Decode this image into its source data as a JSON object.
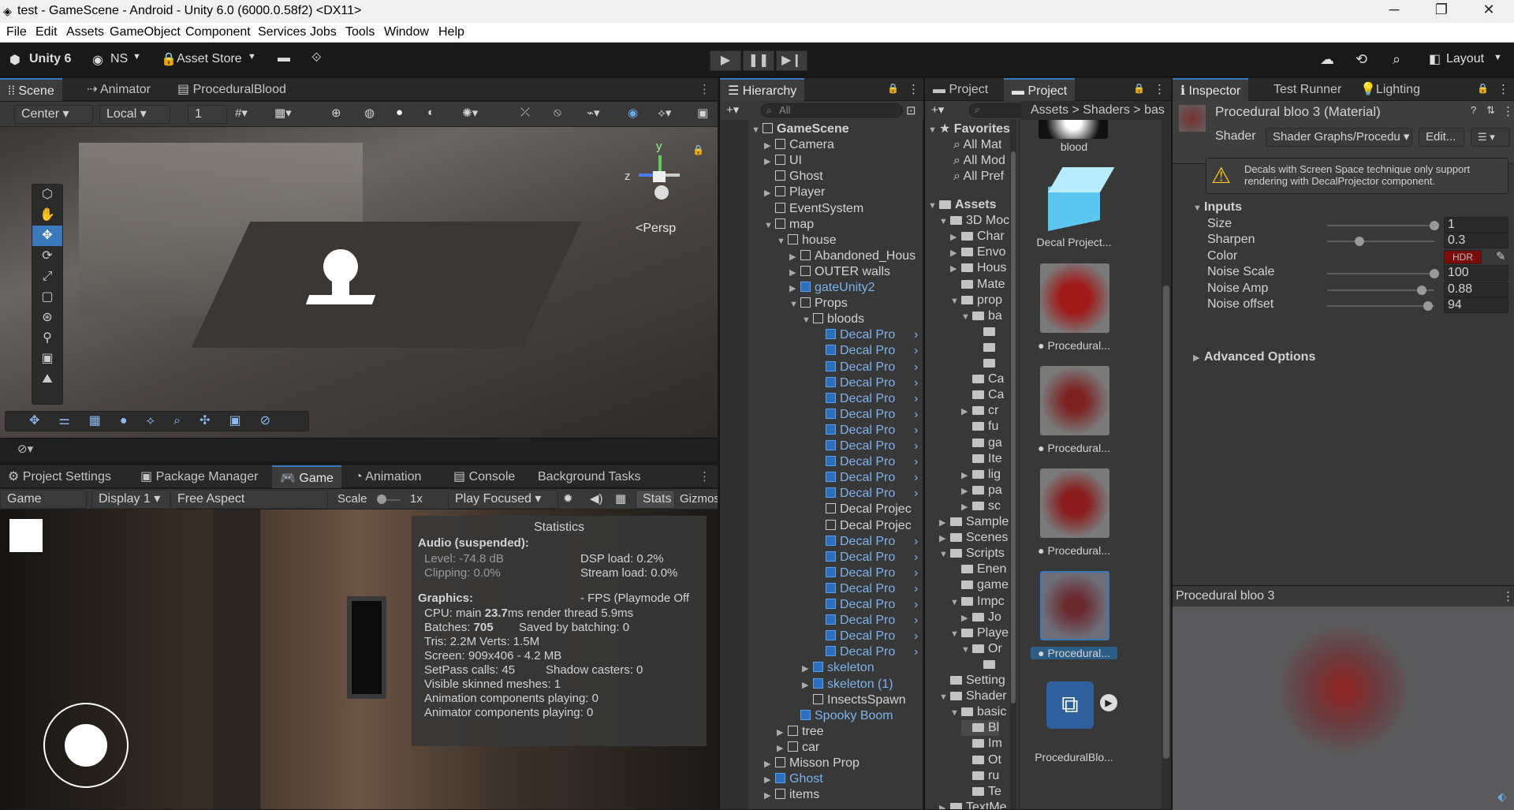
{
  "window": {
    "title": "test - GameScene - Android - Unity 6.0 (6000.0.58f2) <DX11>"
  },
  "menu": [
    "File",
    "Edit",
    "Assets",
    "GameObject",
    "Component",
    "Services",
    "Jobs",
    "Tools",
    "Window",
    "Help"
  ],
  "toolbar": {
    "account": "Unity 6",
    "user": "NS",
    "asset_store": "Asset Store",
    "layout": "Layout"
  },
  "scene_tabs": [
    "Scene",
    "Animator",
    "ProceduralBlood"
  ],
  "scene_toolbar": {
    "pivot": "Center",
    "space": "Local",
    "snap": "1",
    "persp": "<Persp"
  },
  "gizmo_axes": {
    "y": "y",
    "z": "z"
  },
  "game_tabs": [
    "Project Settings",
    "Package Manager",
    "Game",
    "Animation",
    "Console",
    "Background Tasks"
  ],
  "game_toolbar": {
    "mode": "Game",
    "display": "Display 1",
    "aspect": "Free Aspect",
    "scale_label": "Scale",
    "scale_value": "1x",
    "play_mode": "Play Focused",
    "stats": "Stats",
    "gizmos": "Gizmos"
  },
  "stats": {
    "title": "Statistics",
    "audio_header": "Audio (suspended):",
    "level": "Level: -74.8 dB",
    "clipping": "Clipping: 0.0%",
    "dsp": "DSP load: 0.2%",
    "stream": "Stream load: 0.0%",
    "graphics_header": "Graphics:",
    "fps": "- FPS (Playmode Off",
    "cpu_label": "CPU: main ",
    "cpu_main": "23.7",
    "cpu_rest": "ms  render thread 5.9ms",
    "batches_label": "Batches: ",
    "batches": "705",
    "saved": "Saved by batching: 0",
    "tris": "Tris: 2.2M  Verts: 1.5M",
    "screen": "Screen: 909x406 - 4.2 MB",
    "setpass": "SetPass calls: 45",
    "shadow": "Shadow casters: 0",
    "skinned": "Visible skinned meshes: 1",
    "anim": "Animation components playing: 0",
    "animator": "Animator components playing: 0"
  },
  "hierarchy": {
    "tab": "Hierarchy",
    "search_placeholder": "All",
    "items": [
      {
        "label": "GameScene",
        "indent": 0,
        "arrow": "▼",
        "blue": false,
        "bold": true
      },
      {
        "label": "Camera",
        "indent": 1,
        "arrow": "▶",
        "blue": false
      },
      {
        "label": "UI",
        "indent": 1,
        "arrow": "▶",
        "blue": false
      },
      {
        "label": "Ghost",
        "indent": 1,
        "arrow": "",
        "blue": false
      },
      {
        "label": "Player",
        "indent": 1,
        "arrow": "▶",
        "blue": false
      },
      {
        "label": "EventSystem",
        "indent": 1,
        "arrow": "",
        "blue": false
      },
      {
        "label": "map",
        "indent": 1,
        "arrow": "▼",
        "blue": false
      },
      {
        "label": "house",
        "indent": 2,
        "arrow": "▼",
        "blue": false
      },
      {
        "label": "Abandoned_Hous",
        "indent": 3,
        "arrow": "▶",
        "blue": false
      },
      {
        "label": "OUTER walls",
        "indent": 3,
        "arrow": "▶",
        "blue": false
      },
      {
        "label": "gateUnity2",
        "indent": 3,
        "arrow": "▶",
        "blue": true
      },
      {
        "label": "Props",
        "indent": 3,
        "arrow": "▼",
        "blue": false
      },
      {
        "label": "bloods",
        "indent": 4,
        "arrow": "▼",
        "blue": false
      },
      {
        "label": "Decal Pro",
        "indent": 5,
        "arrow": "",
        "blue": true
      },
      {
        "label": "Decal Pro",
        "indent": 5,
        "arrow": "",
        "blue": true
      },
      {
        "label": "Decal Pro",
        "indent": 5,
        "arrow": "",
        "blue": true
      },
      {
        "label": "Decal Pro",
        "indent": 5,
        "arrow": "",
        "blue": true
      },
      {
        "label": "Decal Pro",
        "indent": 5,
        "arrow": "",
        "blue": true
      },
      {
        "label": "Decal Pro",
        "indent": 5,
        "arrow": "",
        "blue": true
      },
      {
        "label": "Decal Pro",
        "indent": 5,
        "arrow": "",
        "blue": true
      },
      {
        "label": "Decal Pro",
        "indent": 5,
        "arrow": "",
        "blue": true
      },
      {
        "label": "Decal Pro",
        "indent": 5,
        "arrow": "",
        "blue": true
      },
      {
        "label": "Decal Pro",
        "indent": 5,
        "arrow": "",
        "blue": true
      },
      {
        "label": "Decal Pro",
        "indent": 5,
        "arrow": "",
        "blue": true
      },
      {
        "label": "Decal Projec",
        "indent": 5,
        "arrow": "",
        "blue": false
      },
      {
        "label": "Decal Projec",
        "indent": 5,
        "arrow": "",
        "blue": false
      },
      {
        "label": "Decal Pro",
        "indent": 5,
        "arrow": "",
        "blue": true
      },
      {
        "label": "Decal Pro",
        "indent": 5,
        "arrow": "",
        "blue": true
      },
      {
        "label": "Decal Pro",
        "indent": 5,
        "arrow": "",
        "blue": true
      },
      {
        "label": "Decal Pro",
        "indent": 5,
        "arrow": "",
        "blue": true
      },
      {
        "label": "Decal Pro",
        "indent": 5,
        "arrow": "",
        "blue": true
      },
      {
        "label": "Decal Pro",
        "indent": 5,
        "arrow": "",
        "blue": true
      },
      {
        "label": "Decal Pro",
        "indent": 5,
        "arrow": "",
        "blue": true
      },
      {
        "label": "Decal Pro",
        "indent": 5,
        "arrow": "",
        "blue": true
      },
      {
        "label": "skeleton",
        "indent": 4,
        "arrow": "▶",
        "blue": true
      },
      {
        "label": "skeleton (1)",
        "indent": 4,
        "arrow": "▶",
        "blue": true
      },
      {
        "label": "InsectsSpawn",
        "indent": 4,
        "arrow": "",
        "blue": false
      },
      {
        "label": "Spooky Boom",
        "indent": 3,
        "arrow": "",
        "blue": true
      },
      {
        "label": "tree",
        "indent": 2,
        "arrow": "▶",
        "blue": false
      },
      {
        "label": "car",
        "indent": 2,
        "arrow": "▶",
        "blue": false
      },
      {
        "label": "Misson Prop",
        "indent": 1,
        "arrow": "▶",
        "blue": false
      },
      {
        "label": "Ghost",
        "indent": 1,
        "arrow": "▶",
        "blue": true
      },
      {
        "label": "items",
        "indent": 1,
        "arrow": "▶",
        "blue": false
      }
    ]
  },
  "project": {
    "tabs": [
      "Project",
      "Project"
    ],
    "breadcrumb": [
      "Assets",
      "Shaders",
      "bas"
    ],
    "favorites_label": "Favorites",
    "favorites": [
      "All Mat",
      "All Mod",
      "All Pref"
    ],
    "tree": [
      {
        "label": "Assets",
        "indent": 0,
        "arrow": "▼",
        "bold": true
      },
      {
        "label": "3D Moc",
        "indent": 1,
        "arrow": "▼"
      },
      {
        "label": "Char",
        "indent": 2,
        "arrow": "▶"
      },
      {
        "label": "Envo",
        "indent": 2,
        "arrow": "▶"
      },
      {
        "label": "Hous",
        "indent": 2,
        "arrow": "▶"
      },
      {
        "label": "Mate",
        "indent": 2,
        "arrow": ""
      },
      {
        "label": "prop",
        "indent": 2,
        "arrow": "▼"
      },
      {
        "label": "ba",
        "indent": 3,
        "arrow": "▼"
      },
      {
        "label": "",
        "indent": 4,
        "arrow": ""
      },
      {
        "label": "",
        "indent": 4,
        "arrow": ""
      },
      {
        "label": "",
        "indent": 4,
        "arrow": ""
      },
      {
        "label": "Ca",
        "indent": 3,
        "arrow": ""
      },
      {
        "label": "Ca",
        "indent": 3,
        "arrow": ""
      },
      {
        "label": "cr",
        "indent": 3,
        "arrow": "▶"
      },
      {
        "label": "fu",
        "indent": 3,
        "arrow": ""
      },
      {
        "label": "ga",
        "indent": 3,
        "arrow": ""
      },
      {
        "label": "Ite",
        "indent": 3,
        "arrow": ""
      },
      {
        "label": "lig",
        "indent": 3,
        "arrow": "▶"
      },
      {
        "label": "pa",
        "indent": 3,
        "arrow": "▶"
      },
      {
        "label": "sc",
        "indent": 3,
        "arrow": "▶"
      },
      {
        "label": "Sample",
        "indent": 1,
        "arrow": "▶"
      },
      {
        "label": "Scenes",
        "indent": 1,
        "arrow": "▶"
      },
      {
        "label": "Scripts",
        "indent": 1,
        "arrow": "▼"
      },
      {
        "label": "Enen",
        "indent": 2,
        "arrow": ""
      },
      {
        "label": "game",
        "indent": 2,
        "arrow": ""
      },
      {
        "label": "Impc",
        "indent": 2,
        "arrow": "▼"
      },
      {
        "label": "Jo",
        "indent": 3,
        "arrow": "▶"
      },
      {
        "label": "Playe",
        "indent": 2,
        "arrow": "▼"
      },
      {
        "label": "Or",
        "indent": 3,
        "arrow": "▼"
      },
      {
        "label": "",
        "indent": 4,
        "arrow": ""
      },
      {
        "label": "Setting",
        "indent": 1,
        "arrow": ""
      },
      {
        "label": "Shader",
        "indent": 1,
        "arrow": "▼"
      },
      {
        "label": "basic",
        "indent": 2,
        "arrow": "▼"
      },
      {
        "label": "Bl",
        "indent": 3,
        "arrow": ""
      },
      {
        "label": "Im",
        "indent": 3,
        "arrow": ""
      },
      {
        "label": "Ot",
        "indent": 3,
        "arrow": ""
      },
      {
        "label": "ru",
        "indent": 3,
        "arrow": ""
      },
      {
        "label": "Te",
        "indent": 3,
        "arrow": ""
      },
      {
        "label": "TextMe",
        "indent": 1,
        "arrow": "▶"
      }
    ],
    "thumbs": [
      {
        "label": "blood"
      },
      {
        "label": "Decal Project..."
      },
      {
        "label": "Procedural..."
      },
      {
        "label": "Procedural..."
      },
      {
        "label": "Procedural..."
      },
      {
        "label": "Procedural..."
      },
      {
        "label": "ProceduralBlo..."
      }
    ]
  },
  "inspector": {
    "tabs": [
      "Inspector",
      "Test Runner",
      "Lighting"
    ],
    "material_title": "Procedural bloo 3 (Material)",
    "shader_label": "Shader",
    "shader_value": "Shader Graphs/Procedu",
    "edit_button": "Edit...",
    "warning": "Decals with Screen Space technique only support rendering with DecalProjector component.",
    "inputs_header": "Inputs",
    "props": [
      {
        "label": "Size",
        "value": "1",
        "pct": 1.0
      },
      {
        "label": "Sharpen",
        "value": "0.3",
        "pct": 0.3
      },
      {
        "label": "Color",
        "value": "HDR",
        "pct": null
      },
      {
        "label": "Noise Scale",
        "value": "100",
        "pct": 1.0
      },
      {
        "label": "Noise Amp",
        "value": "0.88",
        "pct": 0.88
      },
      {
        "label": "Noise offset",
        "value": "94",
        "pct": 0.94
      }
    ],
    "advanced": "Advanced Options",
    "preview_title": "Procedural bloo 3"
  }
}
